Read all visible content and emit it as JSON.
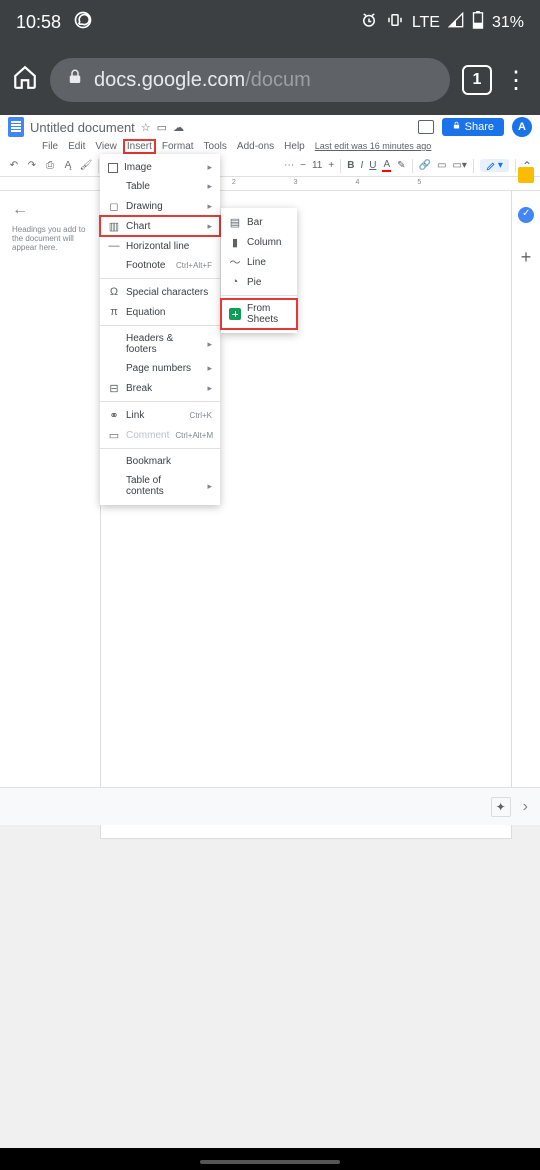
{
  "status_bar": {
    "time": "10:58",
    "signal": "LTE",
    "battery": "31%"
  },
  "browser": {
    "url_host": "docs.google.com",
    "url_path": "/docum",
    "tab_count": "1"
  },
  "docs": {
    "title": "Untitled document",
    "share_label": "Share",
    "avatar_letter": "A",
    "last_edit": "Last edit was 16 minutes ago",
    "menus": [
      "File",
      "Edit",
      "View",
      "Insert",
      "Format",
      "Tools",
      "Add-ons",
      "Help"
    ],
    "highlighted_menu_index": 3,
    "toolbar_font_size": "11",
    "outline_placeholder": "Headings you add to the document will appear here."
  },
  "insert_menu": {
    "items": [
      {
        "label": "Image",
        "icon": "image",
        "arrow": true
      },
      {
        "label": "Table",
        "icon": "",
        "arrow": true
      },
      {
        "label": "Drawing",
        "icon": "drawing",
        "arrow": true
      },
      {
        "label": "Chart",
        "icon": "chart",
        "arrow": true,
        "highlighted": true
      },
      {
        "label": "Horizontal line",
        "icon": "hline"
      },
      {
        "label": "Footnote",
        "icon": "",
        "shortcut": "Ctrl+Alt+F"
      },
      {
        "divider": true
      },
      {
        "label": "Special characters",
        "icon": "omega"
      },
      {
        "label": "Equation",
        "icon": "pi"
      },
      {
        "divider": true
      },
      {
        "label": "Headers & footers",
        "icon": "",
        "arrow": true
      },
      {
        "label": "Page numbers",
        "icon": "",
        "arrow": true
      },
      {
        "label": "Break",
        "icon": "break",
        "arrow": true
      },
      {
        "divider": true
      },
      {
        "label": "Link",
        "icon": "link",
        "shortcut": "Ctrl+K"
      },
      {
        "label": "Comment",
        "icon": "comment",
        "shortcut": "Ctrl+Alt+M",
        "disabled": true
      },
      {
        "divider": true
      },
      {
        "label": "Bookmark",
        "icon": ""
      },
      {
        "label": "Table of contents",
        "icon": "",
        "arrow": true
      }
    ]
  },
  "chart_submenu": {
    "items": [
      {
        "label": "Bar",
        "icon": "bar"
      },
      {
        "label": "Column",
        "icon": "column"
      },
      {
        "label": "Line",
        "icon": "line"
      },
      {
        "label": "Pie",
        "icon": "pie"
      },
      {
        "divider": true
      },
      {
        "label": "From Sheets",
        "icon": "sheets",
        "highlighted": true
      }
    ]
  }
}
